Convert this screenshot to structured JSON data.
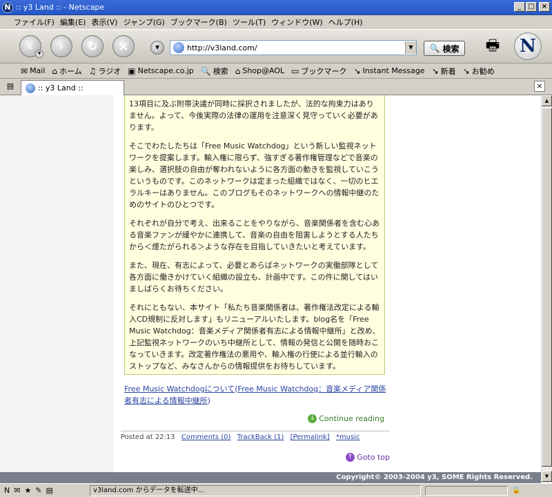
{
  "window": {
    "title": ":: y3 Land :: - Netscape"
  },
  "menu": [
    "ファイル(F)",
    "編集(E)",
    "表示(V)",
    "ジャンプ(G)",
    "ブックマーク(B)",
    "ツール(T)",
    "ウィンドウ(W)",
    "ヘルプ(H)"
  ],
  "toolbar": {
    "url": "http://v3land.com/",
    "search_label": "検索"
  },
  "personal_toolbar": [
    "Mail",
    "ホーム",
    "ラジオ",
    "Netscape.co.jp",
    "検索",
    "Shop@AOL",
    "ブックマーク",
    "Instant Message",
    "新着",
    "お勧め"
  ],
  "tab": {
    "title": ":: y3 Land ::"
  },
  "post": {
    "paragraphs": [
      "13項目に及ぶ附帯決議が同時に採択されましたが、法的な拘束力はありません。よって、今後実際の法律の運用を注意深く見守っていく必要があります。",
      "そこでわたしたちは「Free Music Watchdog」という新しい監視ネットワークを提案します。輸入権に限らず、強すぎる著作権管理などで音楽の楽しみ、選択肢の自由が奪われないように各方面の動きを監視していこうというものです。このネットワークは定まった組織ではなく、一切のヒエラルキーはありません。このブログもそのネットワークへの情報中継のためのサイトのひとつです。",
      "それぞれが自分で考え、出来ることをやりながら、音楽関係者を含む心ある音楽ファンが緩やかに連携して、音楽の自由を阻害しようとする人たちから＜煙たがられる＞ような存在を目指していきたいと考えています。",
      "また、現在、有志によって、必要とあらばネットワークの実働部隊として各方面に働きかけていく組織の設立も、計画中です。この件に関してはいましばらくお待ちください。",
      "それにともない、本サイト「私たち音楽関係者は、著作権法改定による輸入CD規制に反対します」もリニューアルいたします。blog名を「Free Music Watchdog：音楽メディア関係者有志による情報中継所」と改め、上記監視ネットワークのいち中継所として、情報の発信と公開を随時おこなっていきます。改定著作権法の悪用や、輸入権の行使による並行輸入のストップなど、みなさんからの情報提供をお待ちしています。"
    ],
    "more_link_1": "Free Music Watchdogについて",
    "more_link_2": "Free Music Watchdog：音楽メディア関係者有志による情報中継所",
    "continue": "Continue reading",
    "meta": {
      "posted": "Posted at 22:13",
      "comments": "Comments (0)",
      "trackback": "TrackBack (1)",
      "permalink": "[Permalink]",
      "category": "*music"
    },
    "goto_top": "Goto top"
  },
  "footer": {
    "copyright": "Copyright© 2003-2004 y3, SOME Rights Reserved."
  },
  "status": {
    "text": "v3land.com からデータを転送中..."
  }
}
